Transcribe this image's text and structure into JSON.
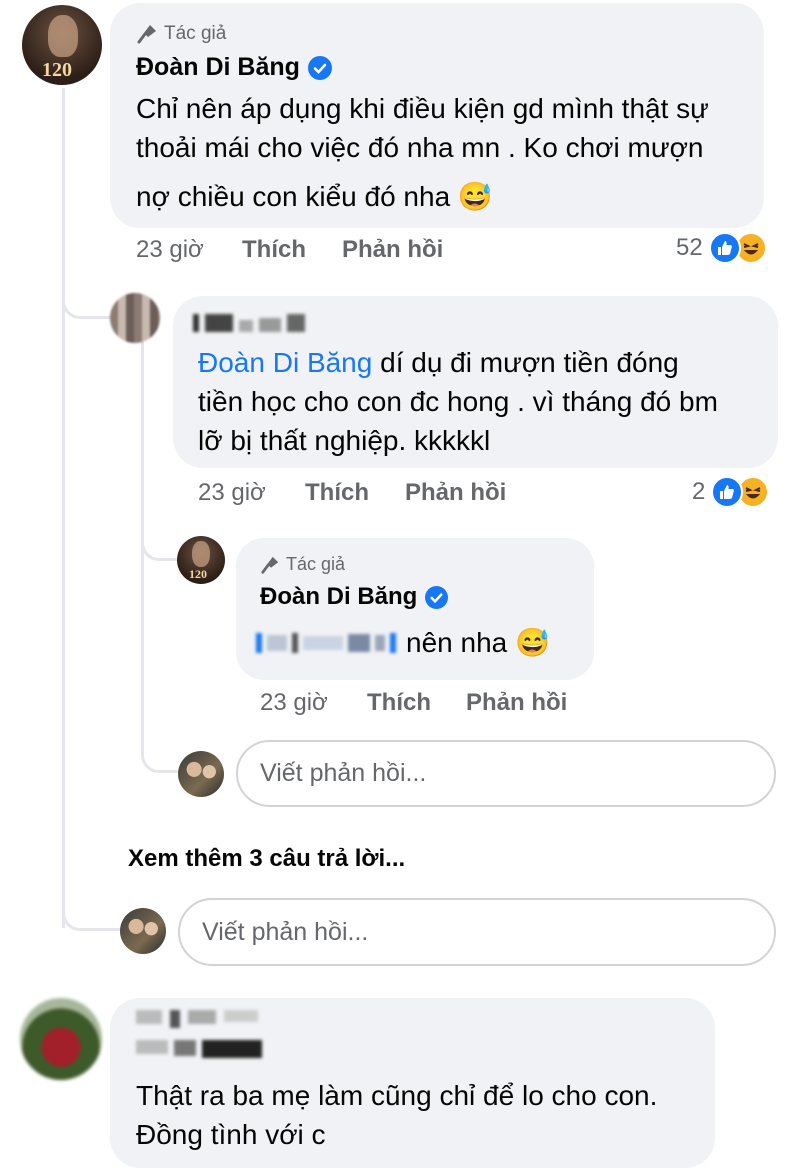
{
  "comment1": {
    "badge": "Tác giả",
    "author": "Đoàn Di Băng",
    "lines": [
      "Chỉ nên áp dụng khi điều kiện gd mình thật sự",
      "thoải mái cho việc đó nha mn . Ko chơi mượn",
      "nợ chiều con kiểu đó nha 😅"
    ],
    "time": "23 giờ",
    "like": "Thích",
    "reply": "Phản hồi",
    "reactions": "52",
    "avatar_text": "120"
  },
  "comment2": {
    "mention": "Đoàn Di Băng",
    "line1_rest": " dí dụ đi mượn tiền đóng",
    "lines": [
      "tiền học cho con đc hong . vì tháng đó bm",
      "lỡ bị thất nghiệp. kkkkkl"
    ],
    "time": "23 giờ",
    "like": "Thích",
    "reply": "Phản hồi",
    "reactions": "2"
  },
  "comment3": {
    "badge": "Tác giả",
    "author": "Đoàn Di Băng",
    "text_rest": "nên nha 😅",
    "time": "23 giờ",
    "like": "Thích",
    "reply": "Phản hồi",
    "avatar_text": "120"
  },
  "reply_placeholder": "Viết phản hồi...",
  "more_replies": "Xem thêm 3 câu trả lời...",
  "comment4": {
    "lines": [
      "Thật ra ba mẹ làm cũng chỉ để lo cho con.",
      "Đồng tình với c"
    ]
  },
  "colors": {
    "accent": "#1877f2",
    "bubble": "#f0f2f5",
    "muted": "#65676b",
    "haha": "#f7b125"
  }
}
